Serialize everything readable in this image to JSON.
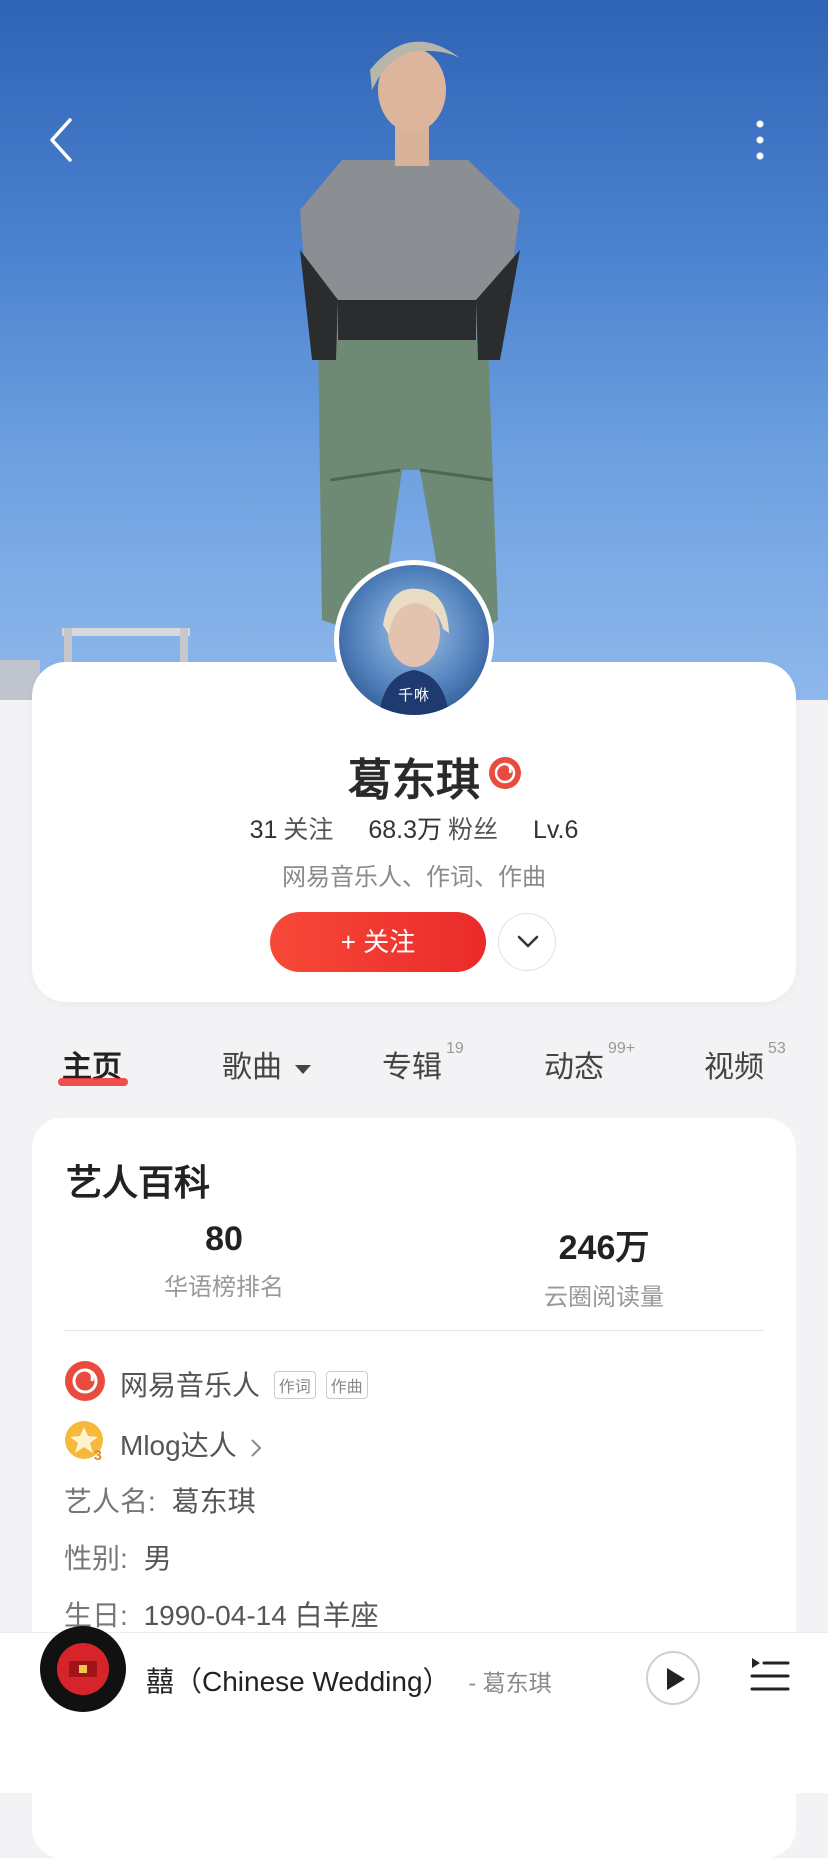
{
  "artist": {
    "name": "葛东琪",
    "avatar_label": "千咻",
    "stats": [
      {
        "value": "31",
        "label": "关注"
      },
      {
        "value": "68.3万",
        "label": "粉丝"
      },
      {
        "value": "Lv.6",
        "label": ""
      }
    ],
    "roles": "网易音乐人、作词、作曲",
    "follow_label": "+ 关注"
  },
  "tabs": [
    {
      "label": "主页",
      "count": ""
    },
    {
      "label": "歌曲",
      "count": ""
    },
    {
      "label": "专辑",
      "count": "19"
    },
    {
      "label": "动态",
      "count": "99+"
    },
    {
      "label": "视频",
      "count": "53"
    }
  ],
  "wiki": {
    "title": "艺人百科",
    "metrics": [
      {
        "value": "80",
        "caption": "华语榜排名"
      },
      {
        "value": "246万",
        "caption": "云圈阅读量"
      }
    ],
    "musician_label": "网易音乐人",
    "musician_tags": [
      "作词",
      "作曲"
    ],
    "mlog_label": "Mlog达人",
    "mlog_level": "3",
    "stage_name_key": "艺人名:",
    "stage_name_value": "葛东琪",
    "gender_key": "性别:",
    "gender_value": "男",
    "birthday_key": "生日:",
    "birthday_value": "1990-04-14 白羊座"
  },
  "player": {
    "song_title": "囍（Chinese Wedding）",
    "song_artist": "- 葛东琪"
  },
  "colors": {
    "accent_red": "#ef3b3b",
    "sky_blue": "#4b82cf"
  }
}
